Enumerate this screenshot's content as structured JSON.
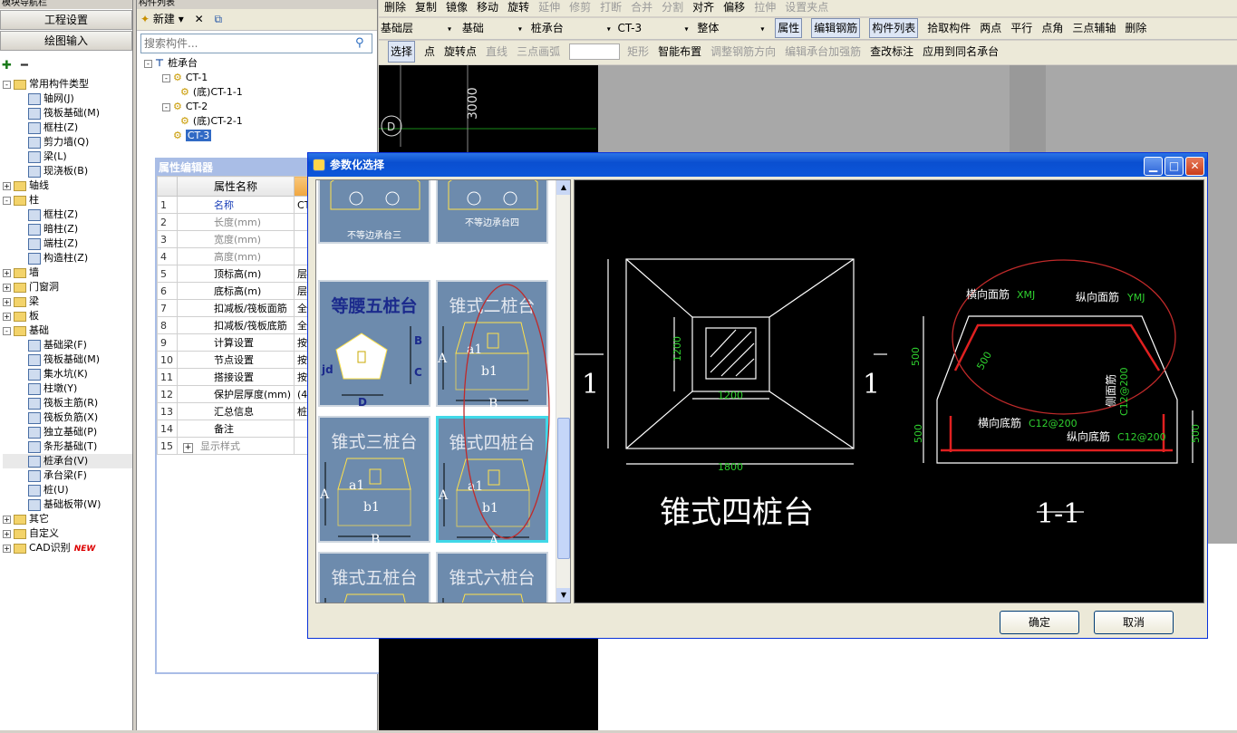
{
  "nav": {
    "title": "模块导航栏",
    "project_settings": "工程设置",
    "drawing_input": "绘图输入",
    "tree": [
      {
        "level": 0,
        "exp": "-",
        "type": "folder",
        "label": "常用构件类型"
      },
      {
        "level": 1,
        "type": "icon",
        "label": "轴网(J)"
      },
      {
        "level": 1,
        "type": "icon",
        "label": "筏板基础(M)"
      },
      {
        "level": 1,
        "type": "icon",
        "label": "框柱(Z)"
      },
      {
        "level": 1,
        "type": "icon",
        "label": "剪力墙(Q)"
      },
      {
        "level": 1,
        "type": "icon",
        "label": "梁(L)"
      },
      {
        "level": 1,
        "type": "icon",
        "label": "现浇板(B)"
      },
      {
        "level": 0,
        "exp": "+",
        "type": "folder",
        "label": "轴线"
      },
      {
        "level": 0,
        "exp": "-",
        "type": "folder",
        "label": "柱"
      },
      {
        "level": 1,
        "type": "icon",
        "label": "框柱(Z)"
      },
      {
        "level": 1,
        "type": "icon",
        "label": "暗柱(Z)"
      },
      {
        "level": 1,
        "type": "icon",
        "label": "端柱(Z)"
      },
      {
        "level": 1,
        "type": "icon",
        "label": "构造柱(Z)"
      },
      {
        "level": 0,
        "exp": "+",
        "type": "folder",
        "label": "墙"
      },
      {
        "level": 0,
        "exp": "+",
        "type": "folder",
        "label": "门窗洞"
      },
      {
        "level": 0,
        "exp": "+",
        "type": "folder",
        "label": "梁"
      },
      {
        "level": 0,
        "exp": "+",
        "type": "folder",
        "label": "板"
      },
      {
        "level": 0,
        "exp": "-",
        "type": "folder",
        "label": "基础"
      },
      {
        "level": 1,
        "type": "icon",
        "label": "基础梁(F)"
      },
      {
        "level": 1,
        "type": "icon",
        "label": "筏板基础(M)"
      },
      {
        "level": 1,
        "type": "icon",
        "label": "集水坑(K)"
      },
      {
        "level": 1,
        "type": "icon",
        "label": "柱墩(Y)"
      },
      {
        "level": 1,
        "type": "icon",
        "label": "筏板主筋(R)"
      },
      {
        "level": 1,
        "type": "icon",
        "label": "筏板负筋(X)"
      },
      {
        "level": 1,
        "type": "icon",
        "label": "独立基础(P)"
      },
      {
        "level": 1,
        "type": "icon",
        "label": "条形基础(T)"
      },
      {
        "level": 1,
        "type": "icon",
        "label": "桩承台(V)",
        "selected": true
      },
      {
        "level": 1,
        "type": "icon",
        "label": "承台梁(F)"
      },
      {
        "level": 1,
        "type": "icon",
        "label": "桩(U)"
      },
      {
        "level": 1,
        "type": "icon",
        "label": "基础板带(W)"
      },
      {
        "level": 0,
        "exp": "+",
        "type": "folder",
        "label": "其它"
      },
      {
        "level": 0,
        "exp": "+",
        "type": "folder",
        "label": "自定义"
      },
      {
        "level": 0,
        "exp": "+",
        "type": "folder",
        "label": "CAD识别",
        "badge": "NEW"
      }
    ]
  },
  "clist": {
    "title": "构件列表",
    "new_label": "新建",
    "search_placeholder": "搜索构件...",
    "tree": [
      {
        "level": 0,
        "label": "桩承台"
      },
      {
        "level": 1,
        "label": "CT-1"
      },
      {
        "level": 2,
        "label": "(底)CT-1-1"
      },
      {
        "level": 1,
        "label": "CT-2"
      },
      {
        "level": 2,
        "label": "(底)CT-2-1"
      },
      {
        "level": 1,
        "label": "CT-3",
        "selected": true
      }
    ]
  },
  "prop": {
    "title": "属性编辑器",
    "col_name": "属性名称",
    "rows": [
      {
        "n": "1",
        "name": "名称",
        "val": "CT-",
        "blue": true
      },
      {
        "n": "2",
        "name": "长度(mm)",
        "val": "",
        "gray": true
      },
      {
        "n": "3",
        "name": "宽度(mm)",
        "val": "",
        "gray": true
      },
      {
        "n": "4",
        "name": "高度(mm)",
        "val": "",
        "gray": true
      },
      {
        "n": "5",
        "name": "顶标高(m)",
        "val": "层底"
      },
      {
        "n": "6",
        "name": "底标高(m)",
        "val": "层底"
      },
      {
        "n": "7",
        "name": "扣减板/筏板面筋",
        "val": "全部"
      },
      {
        "n": "8",
        "name": "扣减板/筏板底筋",
        "val": "全部"
      },
      {
        "n": "9",
        "name": "计算设置",
        "val": "按默"
      },
      {
        "n": "10",
        "name": "节点设置",
        "val": "按默"
      },
      {
        "n": "11",
        "name": "搭接设置",
        "val": "按默"
      },
      {
        "n": "12",
        "name": "保护层厚度(mm)",
        "val": "(40"
      },
      {
        "n": "13",
        "name": "汇总信息",
        "val": "桩承"
      },
      {
        "n": "14",
        "name": "备注",
        "val": ""
      },
      {
        "n": "15",
        "name": "显示样式",
        "val": "",
        "plus": true
      }
    ]
  },
  "toolbar1": [
    "删除",
    "复制",
    "镜像",
    "移动",
    "旋转",
    "延伸",
    "修剪",
    "打断",
    "合并",
    "分割",
    "对齐",
    "偏移",
    "拉伸",
    "设置夹点"
  ],
  "toolbar2": {
    "floor": "基础层",
    "cat": "基础",
    "type": "桩承台",
    "name": "CT-3",
    "mode": "整体",
    "btns": [
      "属性",
      "编辑钢筋",
      "构件列表",
      "拾取构件",
      "两点",
      "平行",
      "点角",
      "三点辅轴",
      "删除"
    ]
  },
  "toolbar3": [
    "选择",
    "点",
    "旋转点",
    "直线",
    "三点画弧",
    "矩形",
    "智能布置",
    "调整钢筋方向",
    "编辑承台加强筋",
    "查改标注",
    "应用到同名承台"
  ],
  "canvas": {
    "dim1": "3000",
    "axis": "D"
  },
  "dialog": {
    "title": "参数化选择",
    "group": "图形",
    "shapes": [
      "不等边承台三",
      "不等边承台四",
      "等腰五桩台",
      "锥式二桩台",
      "锥式三桩台",
      "锥式四桩台",
      "锥式五桩台",
      "锥式六桩台"
    ],
    "shape_labels": {
      "a1": "a1",
      "b1": "b1",
      "A": "A",
      "B": "B",
      "C": "C",
      "D": "D",
      "jd": "jd"
    },
    "preview": {
      "name": "锥式四桩台",
      "section": "1-1",
      "cut": "1",
      "dim_1200a": "1200",
      "dim_1200b": "1200",
      "dim_1800": "1800",
      "dim_500a": "500",
      "dim_500b": "500",
      "dim_500c": "500",
      "dim_500d": "500",
      "top_x": "横向面筋",
      "top_x_code": "XMJ",
      "top_y": "纵向面筋",
      "top_y_code": "YMJ",
      "side": "侧面筋",
      "side_code": "C12@200",
      "bot_x": "横向底筋",
      "bot_x_code": "C12@200",
      "bot_y": "纵向底筋",
      "bot_y_code": "C12@200"
    },
    "ok": "确定",
    "cancel": "取消"
  }
}
